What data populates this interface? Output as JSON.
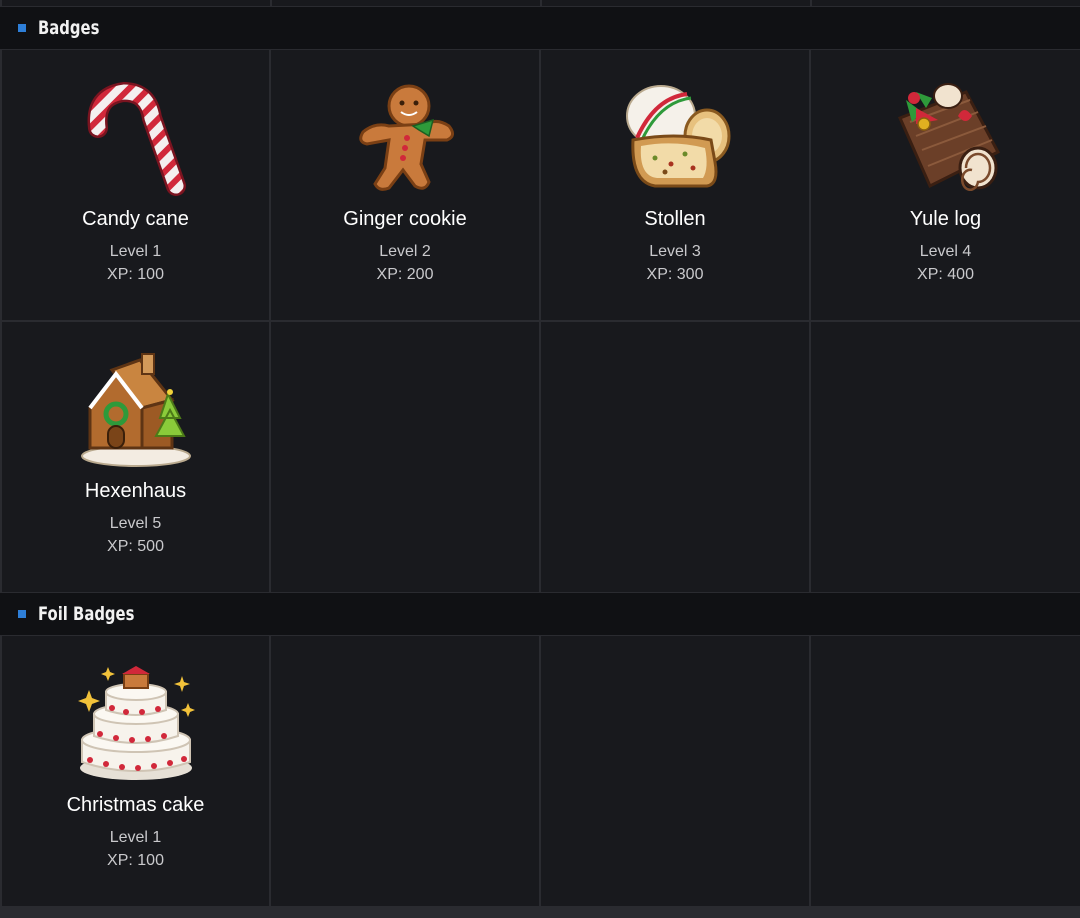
{
  "sections": [
    {
      "title": "Badges",
      "badges": [
        {
          "name": "Candy cane",
          "level": "Level 1",
          "xp": "XP: 100",
          "icon": "candy-cane-icon"
        },
        {
          "name": "Ginger cookie",
          "level": "Level 2",
          "xp": "XP: 200",
          "icon": "gingerbread-man-icon"
        },
        {
          "name": "Stollen",
          "level": "Level 3",
          "xp": "XP: 300",
          "icon": "stollen-icon"
        },
        {
          "name": "Yule log",
          "level": "Level 4",
          "xp": "XP: 400",
          "icon": "yule-log-icon"
        },
        {
          "name": "Hexenhaus",
          "level": "Level 5",
          "xp": "XP: 500",
          "icon": "gingerbread-house-icon"
        }
      ]
    },
    {
      "title": "Foil Badges",
      "badges": [
        {
          "name": "Christmas cake",
          "level": "Level 1",
          "xp": "XP: 100",
          "icon": "christmas-cake-icon"
        }
      ]
    }
  ],
  "colors": {
    "accent": "#2e7fd8",
    "cell_bg": "#18191d",
    "header_bg": "#101114",
    "gridline": "#2a2b30"
  }
}
